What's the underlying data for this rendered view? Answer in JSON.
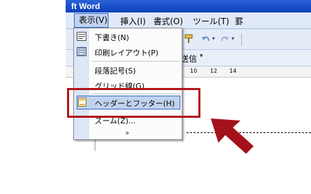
{
  "window": {
    "title_fragment": "ft Word"
  },
  "menubar": {
    "items": [
      "表示(V)",
      "挿入(I)",
      "書式(O)",
      "ツール(T)",
      "罫"
    ],
    "active": "表示(V)"
  },
  "toolbar": {
    "send_label": "送信",
    "ruler_ticks": [
      "10",
      "12",
      "14"
    ]
  },
  "dropdown": {
    "items": [
      {
        "label": "下書き(N)",
        "icon": "draft-view-icon"
      },
      {
        "label": "印刷レイアウト(P)",
        "icon": "print-layout-icon"
      },
      {
        "label": "段落記号(S)",
        "icon": ""
      },
      {
        "label": "グリッド線(G)",
        "icon": ""
      },
      {
        "label": "ヘッダーとフッター(H)",
        "icon": "header-footer-icon",
        "highlighted": true
      },
      {
        "label": "ズーム(Z)...",
        "icon": ""
      }
    ],
    "expand_glyph": "»"
  },
  "annotation": {
    "color": "#b2141a"
  }
}
